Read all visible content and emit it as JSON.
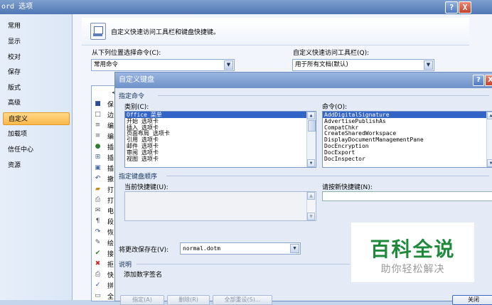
{
  "window": {
    "title": "Word 选项",
    "title_visible": "ord 选项",
    "help": "?",
    "close": "X"
  },
  "nav": [
    "常用",
    "显示",
    "校对",
    "保存",
    "版式",
    "高级",
    "自定义",
    "加载项",
    "信任中心",
    "资源"
  ],
  "nav_selected": "自定义",
  "header": {
    "text": "自定义快速访问工具栏和键盘快捷键。"
  },
  "choose_from": {
    "label": "从下列位置选择命令(C):",
    "value": "常用命令"
  },
  "customize_qat": {
    "label": "自定义快速访问工具栏(Q):",
    "value": "用于所有文档(默认)"
  },
  "left_list": {
    "first_char": "<",
    "items": [
      "保",
      "边",
      "编",
      "编",
      "插",
      "插",
      "插",
      "撤",
      "打",
      "打",
      "电",
      "段",
      "恢",
      "绘",
      "接",
      "拒",
      "快",
      "拼",
      "全"
    ]
  },
  "dialog": {
    "title": "自定义键盘",
    "help": "?",
    "close": "X",
    "section_commands": "指定命令",
    "categories_label": "类别(C):",
    "commands_label": "命令(O):",
    "categories": [
      "Office 菜单",
      "开始 选项卡",
      "插入 选项卡",
      "页面布局 选项卡",
      "引用 选项卡",
      "邮件 选项卡",
      "审阅 选项卡",
      "视图 选项卡"
    ],
    "commands": [
      "AddDigitalSignature",
      "AdvertisePublishAs",
      "CompatChkr",
      "CreateSharedWorkspace",
      "DisplayDocumentManagementPane",
      "DocEncryption",
      "DocExport",
      "DocInspector"
    ],
    "section_keys": "指定键盘顺序",
    "current_keys_label": "当前快捷键(U):",
    "new_key_label": "请按新快捷键(N):",
    "save_in_label": "将更改保存在(V):",
    "save_in_value": "normal.dotm",
    "description_label": "说明",
    "description_text": "添加数字签名",
    "buttons": [
      "指定(A)",
      "删除(R)",
      "全部重设(S)..."
    ],
    "close_button": "关闭"
  },
  "watermark": {
    "title": "百科全说",
    "subtitle": "助你轻松解决"
  }
}
